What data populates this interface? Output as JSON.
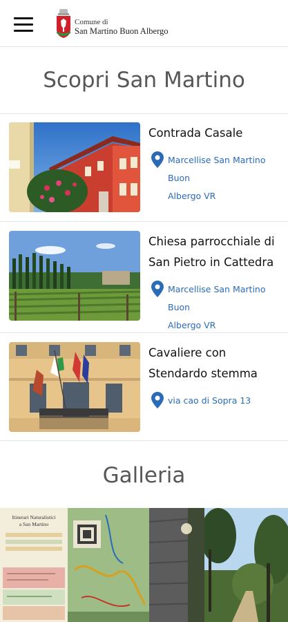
{
  "header": {
    "menu_icon": "hamburger-menu-icon",
    "logo": {
      "line1": "Comune di",
      "line2": "San Martino Buon Albergo",
      "crest_icon": "municipal-crest-icon"
    }
  },
  "discover": {
    "title": "Scopri San Martino",
    "items": [
      {
        "title_lines": [
          "Contrada Casale"
        ],
        "location_lines": [
          "Marcellise San Martino Buon",
          "Albergo VR"
        ],
        "location_icon": "map-pin-icon"
      },
      {
        "title_lines": [
          "Chiesa parrocchiale di",
          "San Pietro in Cattedra"
        ],
        "location_lines": [
          "Marcellise San Martino Buon",
          "Albergo VR"
        ],
        "location_icon": "map-pin-icon"
      },
      {
        "title_lines": [
          "Cavaliere con",
          "Stendardo stemma"
        ],
        "location_lines": [
          "via cao di Sopra 13"
        ],
        "location_icon": "map-pin-icon"
      }
    ]
  },
  "gallery": {
    "title": "Galleria",
    "map_title_lines": [
      "Itinerari Naturalistici",
      "a San Martino"
    ]
  },
  "colors": {
    "link": "#2a6bb8",
    "section_title": "#575757",
    "divider": "#e4e4e4"
  }
}
